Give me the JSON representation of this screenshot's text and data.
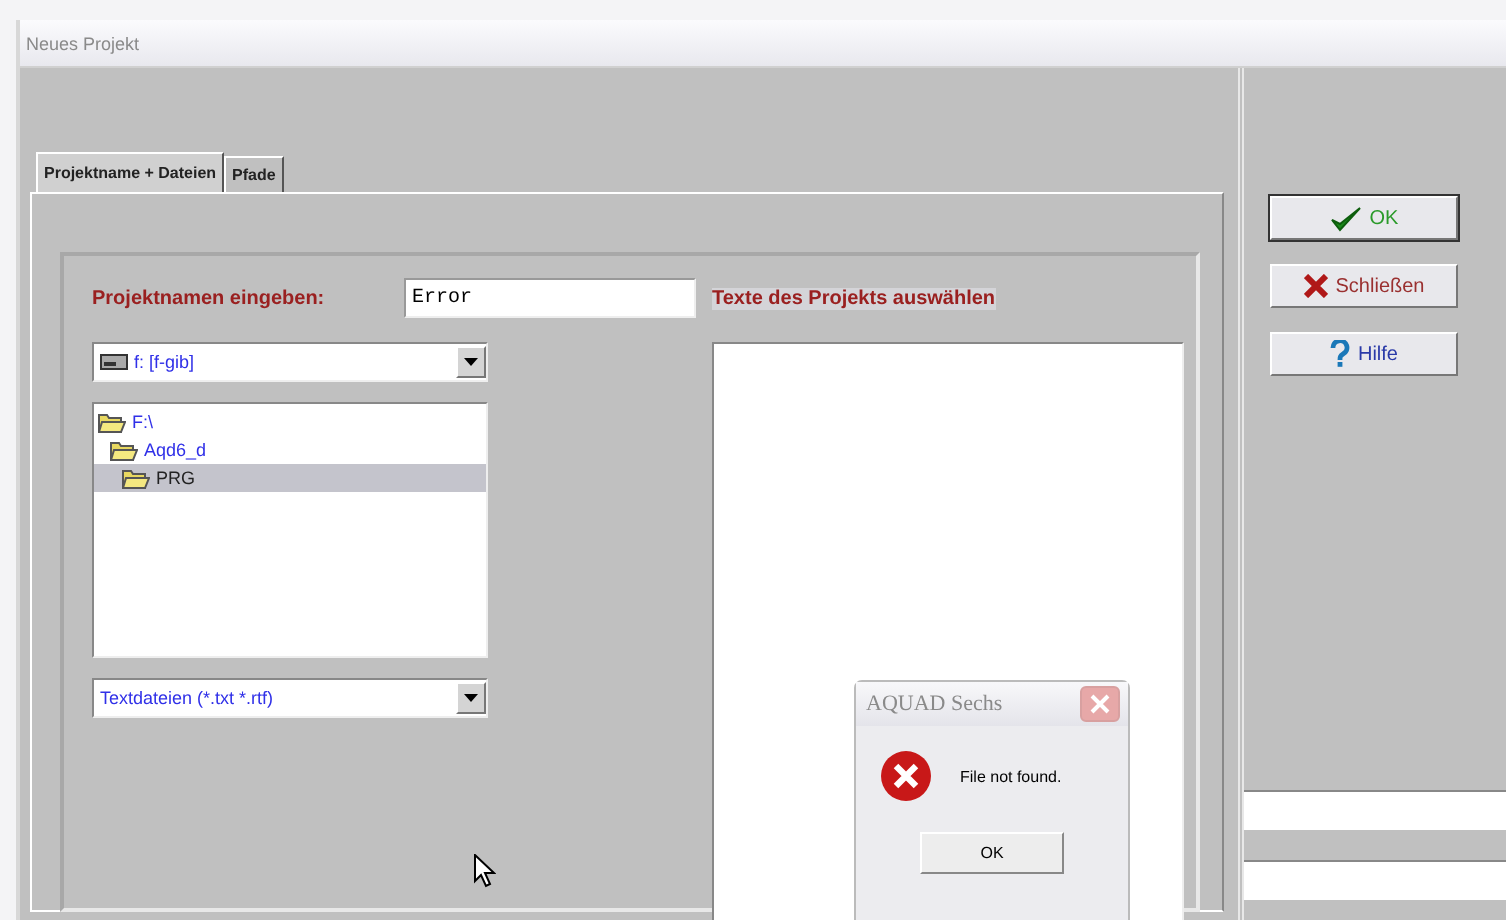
{
  "window": {
    "title": "Neues Projekt"
  },
  "tabs": [
    {
      "label": "Projektname + Dateien",
      "selected": true
    },
    {
      "label": "Pfade",
      "selected": false
    }
  ],
  "project_name": {
    "label": "Projektnamen eingeben:",
    "value": "Error"
  },
  "texts_label": "Texte des Projekts auswählen",
  "drive_combo": {
    "value": "f: [f-gib]"
  },
  "folder_tree": [
    {
      "label": "F:\\",
      "selected": false,
      "children": [
        {
          "label": "Aqd6_d",
          "selected": false,
          "children": [
            {
              "label": "PRG",
              "selected": true
            }
          ]
        }
      ]
    }
  ],
  "filter_combo": {
    "value": "Textdateien (*.txt *.rtf)"
  },
  "buttons": [
    {
      "kind": "ok",
      "label": "OK",
      "default": true
    },
    {
      "kind": "close",
      "label": "Schließen",
      "default": false
    },
    {
      "kind": "help",
      "label": "Hilfe",
      "default": false
    }
  ],
  "message_box": {
    "title": "AQUAD Sechs",
    "message": "File not found.",
    "button": "OK"
  }
}
